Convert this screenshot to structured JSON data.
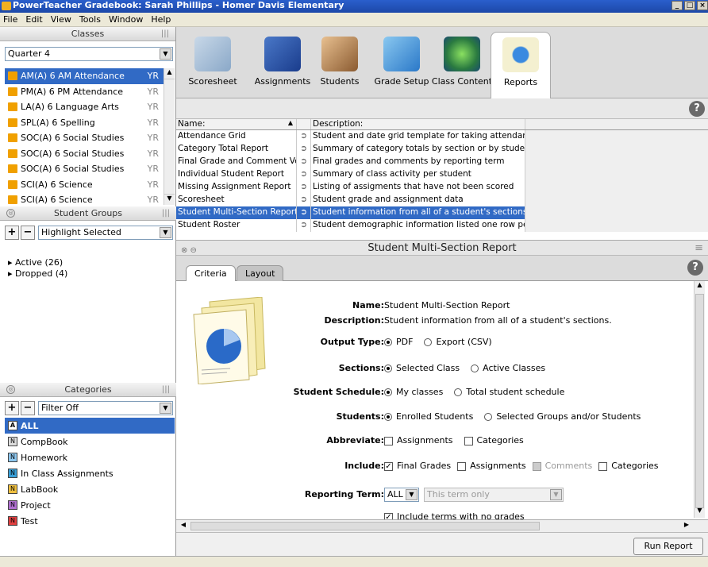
{
  "window": {
    "title": "PowerTeacher Gradebook: Sarah Phillips - Homer Davis Elementary"
  },
  "menu": [
    "File",
    "Edit",
    "View",
    "Tools",
    "Window",
    "Help"
  ],
  "classes": {
    "header": "Classes",
    "term": "Quarter 4",
    "items": [
      {
        "label": "AM(A) 6 AM Attendance",
        "term": "YR"
      },
      {
        "label": "PM(A) 6 PM Attendance",
        "term": "YR"
      },
      {
        "label": "LA(A) 6 Language Arts",
        "term": "YR"
      },
      {
        "label": "SPL(A) 6 Spelling",
        "term": "YR"
      },
      {
        "label": "SOC(A) 6 Social Studies",
        "term": "YR"
      },
      {
        "label": "SOC(A) 6 Social Studies",
        "term": "YR"
      },
      {
        "label": "SOC(A) 6 Social Studies",
        "term": "YR"
      },
      {
        "label": "SCI(A) 6 Science",
        "term": "YR"
      },
      {
        "label": "SCI(A) 6 Science",
        "term": "YR"
      }
    ]
  },
  "student_groups": {
    "header": "Student Groups",
    "filter": "Highlight Selected",
    "items": [
      "Active (26)",
      "Dropped (4)"
    ]
  },
  "categories": {
    "header": "Categories",
    "filter": "Filter Off",
    "items": [
      "ALL",
      "CompBook",
      "Homework",
      "In Class Assignments",
      "LabBook",
      "Project",
      "Test"
    ]
  },
  "toolbar": {
    "items": [
      "Scoresheet",
      "Assignments",
      "Students",
      "Grade Setup",
      "Class Content",
      "Reports"
    ]
  },
  "reports_table": {
    "col_name": "Name:",
    "col_desc": "Description:",
    "rows": [
      {
        "name": "Attendance Grid",
        "desc": "Student and date grid template for taking attendance"
      },
      {
        "name": "Category Total Report",
        "desc": "Summary of category totals by section or by student"
      },
      {
        "name": "Final Grade and Comment Ver...",
        "desc": "Final grades and comments by reporting term"
      },
      {
        "name": "Individual Student Report",
        "desc": "Summary of class activity per student"
      },
      {
        "name": "Missing Assignment Report",
        "desc": "Listing of assigments that have not been scored"
      },
      {
        "name": "Scoresheet",
        "desc": "Student grade and assignment data"
      },
      {
        "name": "Student Multi-Section Report",
        "desc": "Student information from all of a student's sections."
      },
      {
        "name": "Student Roster",
        "desc": "Student demographic information listed one row per ..."
      }
    ]
  },
  "report_panel": {
    "title": "Student Multi-Section Report",
    "tabs": [
      "Criteria",
      "Layout"
    ],
    "name_label": "Name:",
    "name_value": "Student Multi-Section Report",
    "desc_label": "Description:",
    "desc_value": "Student information from all of a student's sections.",
    "output_label": "Output Type:",
    "output_opts": [
      "PDF",
      "Export (CSV)"
    ],
    "sections_label": "Sections:",
    "sections_opts": [
      "Selected Class",
      "Active Classes"
    ],
    "schedule_label": "Student Schedule:",
    "schedule_opts": [
      "My classes",
      "Total student schedule"
    ],
    "students_label": "Students:",
    "students_opts": [
      "Enrolled Students",
      "Selected Groups and/or Students"
    ],
    "abbrev_label": "Abbreviate:",
    "abbrev_opts": [
      "Assignments",
      "Categories"
    ],
    "include_label": "Include:",
    "include_opts": [
      "Final Grades",
      "Assignments",
      "Comments",
      "Categories"
    ],
    "term_label": "Reporting Term:",
    "term_value": "ALL",
    "term_select": "This term only",
    "include_terms": "Include terms with no grades",
    "run_button": "Run Report"
  }
}
